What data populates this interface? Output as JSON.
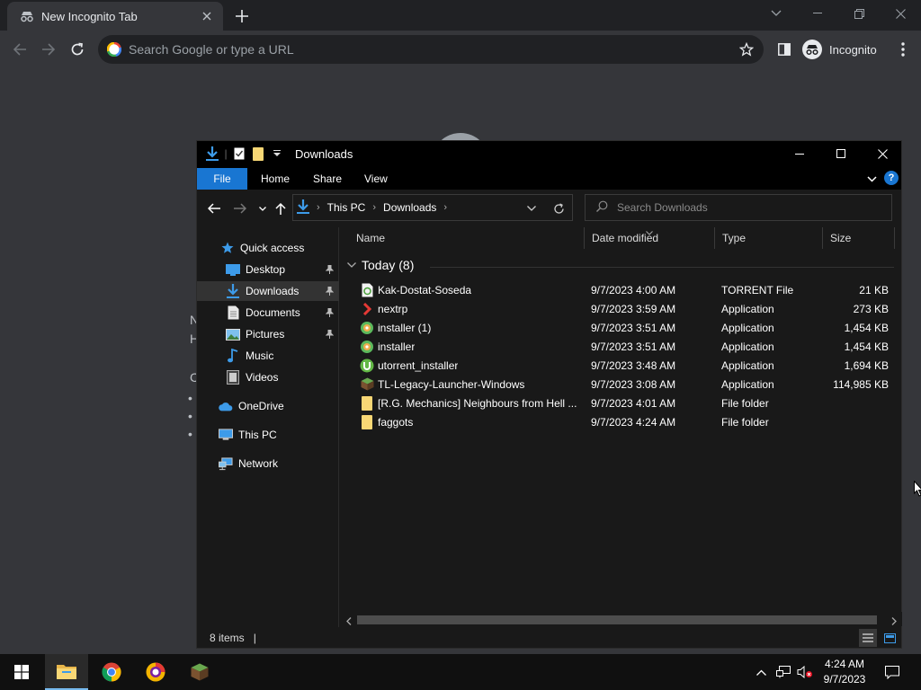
{
  "chrome": {
    "tab_title": "New Incognito Tab",
    "omnibox_placeholder": "Search Google or type a URL",
    "incognito_label": "Incognito",
    "bg_fragments": [
      "N",
      "H",
      "C",
      "•",
      "•",
      "•"
    ]
  },
  "explorer": {
    "window_title": "Downloads",
    "ribbon_tabs": [
      "File",
      "Home",
      "Share",
      "View"
    ],
    "help_label": "?",
    "breadcrumbs": [
      "This PC",
      "Downloads"
    ],
    "search_placeholder": "Search Downloads",
    "nav_pane": [
      {
        "label": "Quick access",
        "icon": "star-icon",
        "pinned": false
      },
      {
        "label": "Desktop",
        "icon": "desktop-icon",
        "pinned": true
      },
      {
        "label": "Downloads",
        "icon": "downloads-icon",
        "pinned": true,
        "selected": true
      },
      {
        "label": "Documents",
        "icon": "documents-icon",
        "pinned": true
      },
      {
        "label": "Pictures",
        "icon": "pictures-icon",
        "pinned": true
      },
      {
        "label": "Music",
        "icon": "music-icon",
        "pinned": false
      },
      {
        "label": "Videos",
        "icon": "videos-icon",
        "pinned": false
      },
      {
        "label": "OneDrive",
        "icon": "cloud-icon",
        "pinned": false
      },
      {
        "label": "This PC",
        "icon": "computer-icon",
        "pinned": false
      },
      {
        "label": "Network",
        "icon": "network-icon",
        "pinned": false
      }
    ],
    "columns": [
      "Name",
      "Date modified",
      "Type",
      "Size"
    ],
    "group_header": "Today (8)",
    "files": [
      {
        "name": "Kak-Dostat-Soseda",
        "date": "9/7/2023 4:00 AM",
        "type": "TORRENT File",
        "size": "21 KB",
        "icon": "torrent-file-icon"
      },
      {
        "name": "nextrp",
        "date": "9/7/2023 3:59 AM",
        "type": "Application",
        "size": "273 KB",
        "icon": "nextrp-app-icon"
      },
      {
        "name": "installer (1)",
        "date": "9/7/2023 3:51 AM",
        "type": "Application",
        "size": "1,454 KB",
        "icon": "installer-app-icon"
      },
      {
        "name": "installer",
        "date": "9/7/2023 3:51 AM",
        "type": "Application",
        "size": "1,454 KB",
        "icon": "installer-app-icon"
      },
      {
        "name": "utorrent_installer",
        "date": "9/7/2023 3:48 AM",
        "type": "Application",
        "size": "1,694 KB",
        "icon": "utorrent-app-icon"
      },
      {
        "name": "TL-Legacy-Launcher-Windows",
        "date": "9/7/2023 3:08 AM",
        "type": "Application",
        "size": "114,985 KB",
        "icon": "launcher-app-icon"
      },
      {
        "name": "[R.G. Mechanics] Neighbours from Hell ...",
        "date": "9/7/2023 4:01 AM",
        "type": "File folder",
        "size": "",
        "icon": "folder-icon"
      },
      {
        "name": "faggots",
        "date": "9/7/2023 4:24 AM",
        "type": "File folder",
        "size": "",
        "icon": "folder-icon"
      }
    ],
    "status_items": "8 items"
  },
  "taskbar": {
    "time": "4:24 AM",
    "date": "9/7/2023",
    "apps": [
      "start-icon",
      "file-explorer-icon",
      "chrome-icon",
      "browser-icon",
      "minecraft-icon"
    ]
  },
  "colors": {
    "chrome_frame": "#202124",
    "chrome_toolbar": "#35363a",
    "explorer_bg": "#191919",
    "accent": "#1976d2",
    "folder": "#f8d775"
  }
}
